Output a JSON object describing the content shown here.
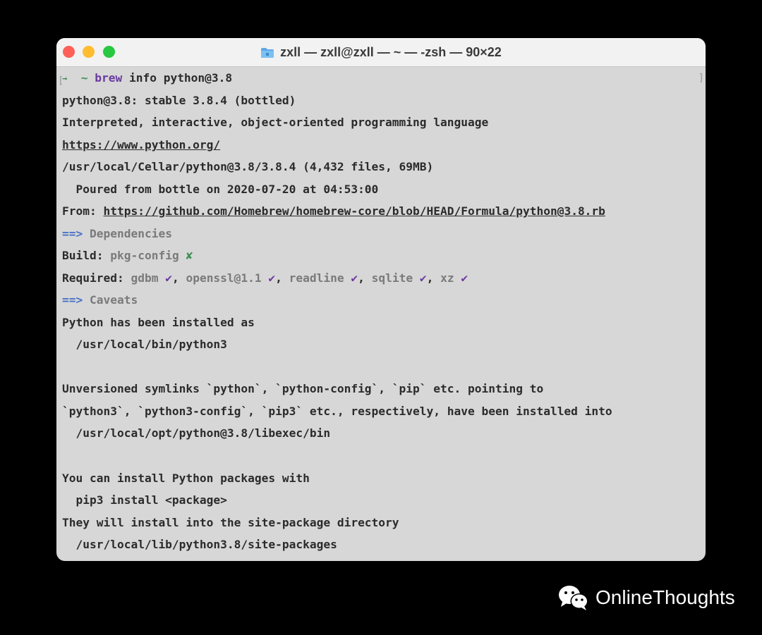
{
  "window": {
    "title": "zxll — zxll@zxll — ~ — -zsh — 90×22",
    "title_icon": "folder-icon"
  },
  "terminal": {
    "prompt_bracket_open": "[",
    "prompt_arrow": "→",
    "prompt_tilde": "~",
    "prompt_command": "brew",
    "prompt_args": "info python@3.8",
    "right_bracket": "]",
    "lines": {
      "l02": "python@3.8: stable 3.8.4 (bottled)",
      "l03": "Interpreted, interactive, object-oriented programming language",
      "l04": "https://www.python.org/",
      "l05": "/usr/local/Cellar/python@3.8/3.8.4 (4,432 files, 69MB)",
      "l06": "  Poured from bottle on 2020-07-20 at 04:53:00",
      "l07_label": "From: ",
      "l07_url": "https://github.com/Homebrew/homebrew-core/blob/HEAD/Formula/python@3.8.rb",
      "l08_arrow": "==>",
      "l08_text": " Dependencies",
      "l09_label": "Build: ",
      "l09_dep": "pkg-config",
      "l09_mark": "✘",
      "l10_label": "Required: ",
      "l10_dep1": "gdbm",
      "l10_dep2": "openssl@1.1",
      "l10_dep3": "readline",
      "l10_dep4": "sqlite",
      "l10_dep5": "xz",
      "check": "✔",
      "comma": ", ",
      "l11_arrow": "==>",
      "l11_text": " Caveats",
      "l12": "Python has been installed as",
      "l13": "  /usr/local/bin/python3",
      "l15": "Unversioned symlinks `python`, `python-config`, `pip` etc. pointing to",
      "l16": "`python3`, `python3-config`, `pip3` etc., respectively, have been installed into",
      "l17": "  /usr/local/opt/python@3.8/libexec/bin",
      "l19": "You can install Python packages with",
      "l20": "  pip3 install <package>",
      "l21": "They will install into the site-package directory",
      "l22": "  /usr/local/lib/python3.8/site-packages"
    }
  },
  "watermark": {
    "text": "OnlineThoughts",
    "icon": "wechat-icon"
  },
  "colors": {
    "background": "#000000",
    "terminal_bg": "#d7d7d7",
    "titlebar_bg": "#f2f2f2",
    "close": "#fe5f57",
    "minimize": "#febc2e",
    "zoom": "#28c840",
    "prompt_green": "#3f8f57",
    "purple": "#6a3aa0",
    "heading_blue": "#4a72c4"
  }
}
